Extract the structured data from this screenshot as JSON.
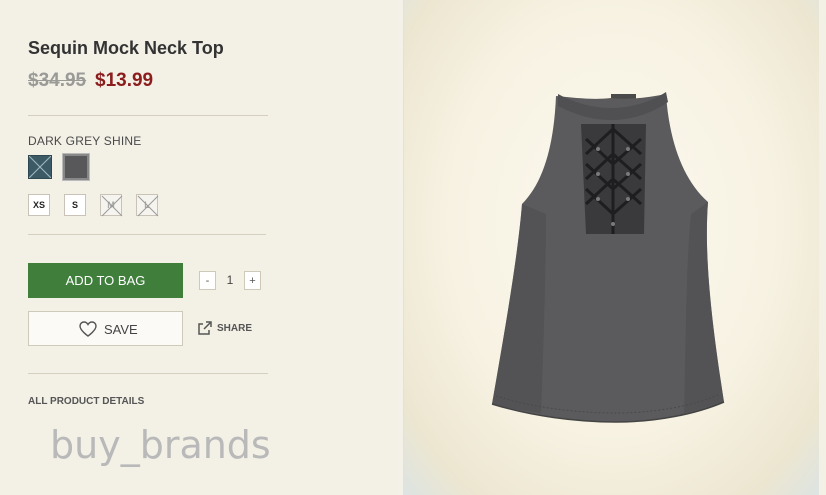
{
  "product": {
    "title": "Sequin Mock Neck Top",
    "old_price": "$34.95",
    "new_price": "$13.99",
    "color_name": "DARK GREY SHINE",
    "swatches": [
      {
        "name": "teal",
        "color": "#3c5a66",
        "available": false
      },
      {
        "name": "dark grey shine",
        "color": "#58585a",
        "available": true,
        "selected": true
      }
    ],
    "sizes": [
      {
        "label": "XS",
        "available": true
      },
      {
        "label": "S",
        "available": true
      },
      {
        "label": "M",
        "available": false
      },
      {
        "label": "L",
        "available": false
      }
    ]
  },
  "actions": {
    "add_to_bag": "ADD TO BAG",
    "qty_minus": "-",
    "qty_value": "1",
    "qty_plus": "+",
    "save": "SAVE",
    "share": "SHARE"
  },
  "details_link": "ALL PRODUCT DETAILS",
  "watermark": "buy_brands",
  "colors": {
    "accent_green": "#3f7e3b",
    "sale_red": "#8b1d1d"
  }
}
